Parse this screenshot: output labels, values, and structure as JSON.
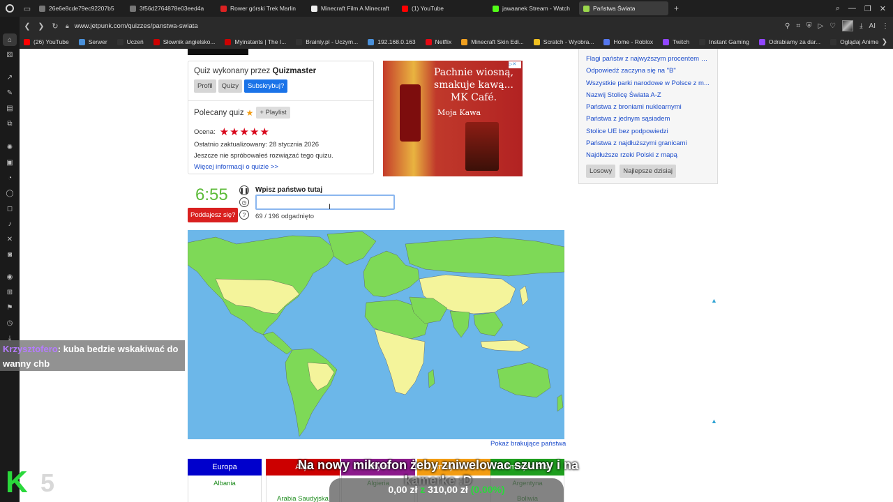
{
  "browser": {
    "tabs": [
      {
        "title": "26e6e8cde79ec92207b5",
        "color": "#777"
      },
      {
        "title": "3f56d2764878e03eed4a",
        "color": "#777"
      },
      {
        "title": "Rower górski Trek Marlin",
        "color": "#d22"
      },
      {
        "title": "Minecraft Film A Minecraft",
        "color": "#eee"
      },
      {
        "title": "(1) YouTube",
        "color": "#f00"
      },
      {
        "title": "jawaanek Stream - Watch",
        "color": "#53fc18"
      },
      {
        "title": "Państwa Świata",
        "color": "#9bd84c",
        "active": true
      }
    ],
    "url": "www.jetpunk.com/quizzes/panstwa-swiata",
    "bookmarks": [
      {
        "label": "(26) YouTube",
        "color": "#f00"
      },
      {
        "label": "Serwer",
        "color": "#4a90d9"
      },
      {
        "label": "Uczeń",
        "color": "#333"
      },
      {
        "label": "Słownik angielsko...",
        "color": "#c00"
      },
      {
        "label": "Myinstants | The I...",
        "color": "#c00"
      },
      {
        "label": "Brainly.pl - Uczym...",
        "color": "#333"
      },
      {
        "label": "192.168.0.163",
        "color": "#4a90d9"
      },
      {
        "label": "Netflix",
        "color": "#e50914"
      },
      {
        "label": "Minecraft Skin Edi...",
        "color": "#f0a020"
      },
      {
        "label": "Scratch - Wyobra...",
        "color": "#f0c020"
      },
      {
        "label": "Home - Roblox",
        "color": "#5577ee"
      },
      {
        "label": "Twitch",
        "color": "#9146ff"
      },
      {
        "label": "Instant Gaming",
        "color": "#333"
      },
      {
        "label": "Odrabiamy za dar...",
        "color": "#9146ff"
      },
      {
        "label": "Oglądaj Anime",
        "color": "#333"
      }
    ]
  },
  "quiz_info": {
    "made_by_prefix": "Quiz wykonany przez",
    "author": "Quizmaster",
    "buttons": [
      "Profil",
      "Quizy",
      "Subskrybuj?"
    ],
    "recommended": "Polecany quiz",
    "playlist": "+ Playlist",
    "rating_label": "Ocena:",
    "rating": 5,
    "updated": "Ostatnio zaktualizowany: 28 stycznia 2026",
    "not_tried": "Jeszcze nie spróbowałeś rozwiązać tego quizu.",
    "more_info": "Więcej informacji o quizie >>"
  },
  "ad": {
    "headline": "Pachnie wiosną, smakuje kawą... MK Café.",
    "brand": "Moja Kawa"
  },
  "related": {
    "links": [
      "Flagi państw z najwyższym procentem bieli",
      "Odpowiedź zaczyna się na \"B\"",
      "Wszystkie parki narodowe w Polsce z m...",
      "Nazwij Stolicę Świata A-Z",
      "Państwa z broniami nuklearnymi",
      "Państwa z jednym sąsiadem",
      "Stolice UE bez podpowiedzi",
      "Państwa z najdłuższymi granicami",
      "Najdłuższe rzeki Polski z mapą"
    ],
    "buttons": [
      "Losowy",
      "Najlepsze dzisiaj"
    ]
  },
  "game": {
    "timer": "6:55",
    "give_up": "Poddajesz się?",
    "prompt": "Wpisz państwo tutaj",
    "answer_value": "",
    "progress": "69 / 196 odgadnięto",
    "guessed": 69,
    "total": 196,
    "show_missing": "Pokaż brakujące państwa"
  },
  "continents": [
    {
      "name": "Europa",
      "color": "#0000cc",
      "first": "Albania",
      "second": ""
    },
    {
      "name": "Azja",
      "color": "#cc0000",
      "first": "",
      "second": "Arabia Saudyjska"
    },
    {
      "name": "Afryka",
      "color": "#8b1a8b",
      "first": "Algieria",
      "second": ""
    },
    {
      "name": "Ameryka Płn.",
      "color": "#f39c12",
      "first": "",
      "second": ""
    },
    {
      "name": "Ameryka Płd.",
      "color": "#1e9e1e",
      "first": "Argentyna",
      "second": "Boliwia"
    }
  ],
  "overlay": {
    "chat_user": "Krzysztofero",
    "chat_message": ": kuba bedzie wskakiwać do wanny chb",
    "stream_text": "Na nowy mikrofon żeby zniwelowac szumy i na kamerke :D",
    "donation_current": "0,00 zł",
    "donation_of": "z",
    "donation_goal": "310,00 zł",
    "donation_pct": "(0.00%)",
    "logo_number": "5"
  },
  "map_colors": {
    "ocean": "#6cb7e9",
    "guessed": "#7ed957",
    "missing": "#f4f49b"
  }
}
